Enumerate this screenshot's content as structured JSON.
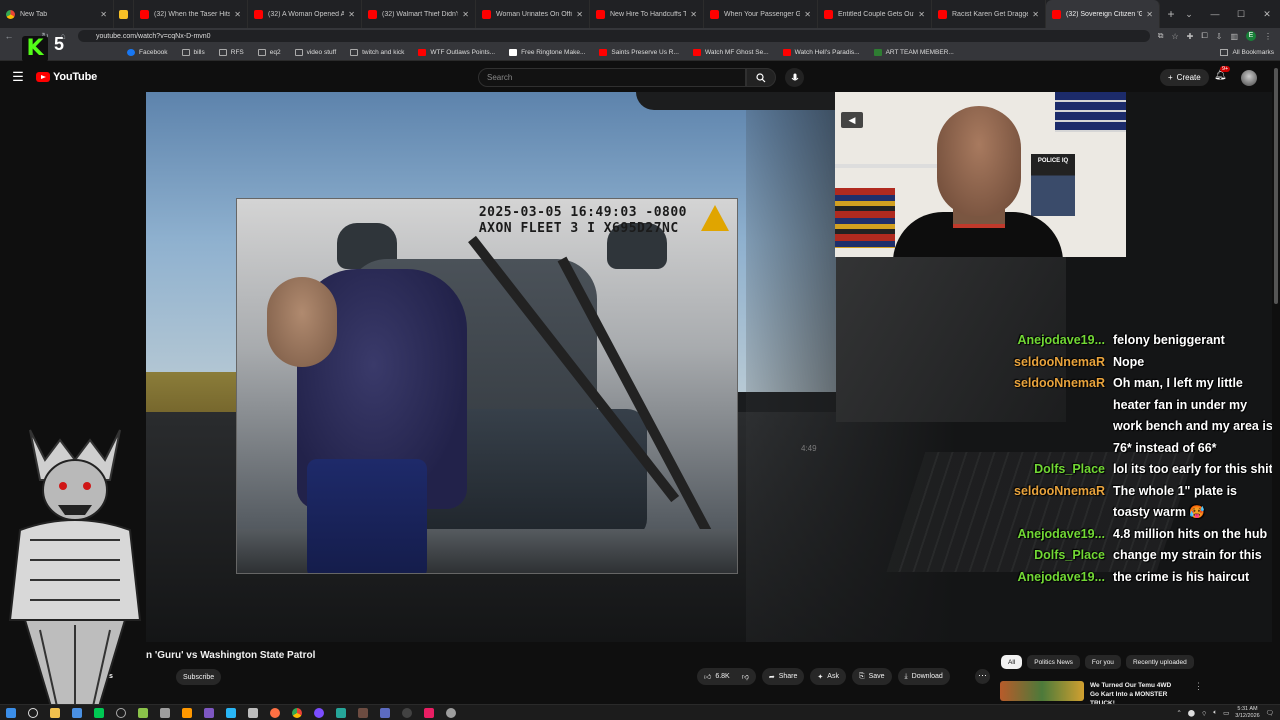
{
  "browser": {
    "tabs": [
      {
        "title": "New Tab",
        "icon": "chrome-icon"
      },
      {
        "title": "",
        "icon": "yellow-square-icon"
      },
      {
        "title": "(32) When the Taser Hits- Sa...",
        "icon": "youtube-icon"
      },
      {
        "title": "(32) A Woman Opened A Cop...",
        "icon": "youtube-icon"
      },
      {
        "title": "(32) Walmart Thief Didn't Kn...",
        "icon": "youtube-icon"
      },
      {
        "title": "Woman Urinates On Officers...",
        "icon": "youtube-icon"
      },
      {
        "title": "New Hire To Handcuffs The Si...",
        "icon": "youtube-icon"
      },
      {
        "title": "When Your Passenger Gets T...",
        "icon": "youtube-icon"
      },
      {
        "title": "Entitled Couple Gets Outsma...",
        "icon": "youtube-icon"
      },
      {
        "title": "Racist Karen Get Dragged Ou...",
        "icon": "youtube-icon"
      },
      {
        "title": "(32) Sovereign Citizen 'G...",
        "icon": "youtube-icon"
      }
    ],
    "url": "youtube.com/watch?v=cqNx-D-mvn0",
    "bookmarks": [
      "Facebook",
      "bills",
      "RFS",
      "eq2",
      "video stuff",
      "twitch and kick",
      "WTF Outlaws Points...",
      "Free Ringtone Make...",
      "Saints Preserve Us R...",
      "Watch MF Ghost Se...",
      "Watch Hell's Paradis...",
      "ART TEAM MEMBER..."
    ],
    "all_bookmarks": "All Bookmarks",
    "profile_initial": "E"
  },
  "overlay": {
    "kick_letter": "K",
    "kick_number": "5"
  },
  "youtube": {
    "logo": "YouTube",
    "search_placeholder": "Search",
    "create_label": "Create",
    "notif_badge": "9+"
  },
  "video": {
    "bodycam_line1": "2025-03-05 16:49:03 -0800",
    "bodycam_line2": "AXON FLEET 3 I X695D27NC",
    "poster_text": "POLICE IQ",
    "clock": "4:49"
  },
  "chat": [
    {
      "user": "Anejodave19...",
      "color": "#72d835",
      "text": "felony beniggerant"
    },
    {
      "user": "seldooNnemaR",
      "color": "#e8a33d",
      "text": "Nope"
    },
    {
      "user": "seldooNnemaR",
      "color": "#e8a33d",
      "text": "Oh man, I left my little heater fan in under my work bench and my area is 76* instead of 66*"
    },
    {
      "user": "Dolfs_Place",
      "color": "#72d835",
      "text": "lol its too early for this shit"
    },
    {
      "user": "seldooNnemaR",
      "color": "#e8a33d",
      "text": "The whole 1\" plate is toasty warm 🥵"
    },
    {
      "user": "Anejodave19...",
      "color": "#72d835",
      "text": "4.8 million hits on the hub"
    },
    {
      "user": "Dolfs_Place",
      "color": "#72d835",
      "text": "change my strain for this"
    },
    {
      "user": "Anejodave19...",
      "color": "#72d835",
      "text": "the crime is his haircut"
    }
  ],
  "below": {
    "title": "n 'Guru' vs Washington State Patrol",
    "channel": "tis",
    "subscribers": "1",
    "subscribe": "Subscribe",
    "likes": "6.8K",
    "share": "Share",
    "ask": "Ask",
    "save": "Save",
    "download": "Download",
    "chips": [
      "All",
      "Politics News",
      "For you",
      "Recently uploaded"
    ],
    "rec_title": "We Turned Our Temu 4WD Go Kart Into a MONSTER TRUCK!"
  },
  "taskbar": {
    "time": "5:31 AM",
    "date": "3/12/2026"
  }
}
